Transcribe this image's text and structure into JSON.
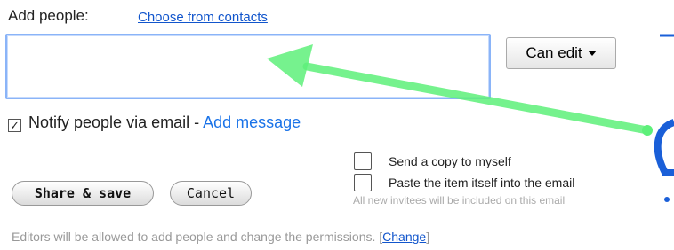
{
  "add_people": {
    "label": "Add people:",
    "choose_link": "Choose from contacts",
    "input_value": "",
    "permission": "Can edit"
  },
  "notify": {
    "checked": true,
    "check_glyph": "✓",
    "label": "Notify people via email - ",
    "add_message": "Add message"
  },
  "options": {
    "send_copy": "Send a copy to myself",
    "paste_item": "Paste the item itself into the email",
    "invitees_note": "All new invitees will be included on this email"
  },
  "buttons": {
    "share": "Share & save",
    "cancel": "Cancel"
  },
  "footer": {
    "editors_note": "Editors will be allowed to add people and change the permissions. [",
    "change": "Change",
    "close_bracket": "]"
  },
  "colors": {
    "link": "#1155cc",
    "add_message": "#1a73e8",
    "annotation_arrow": "#5ef07a",
    "overlay_blue": "#1a5fd8"
  }
}
